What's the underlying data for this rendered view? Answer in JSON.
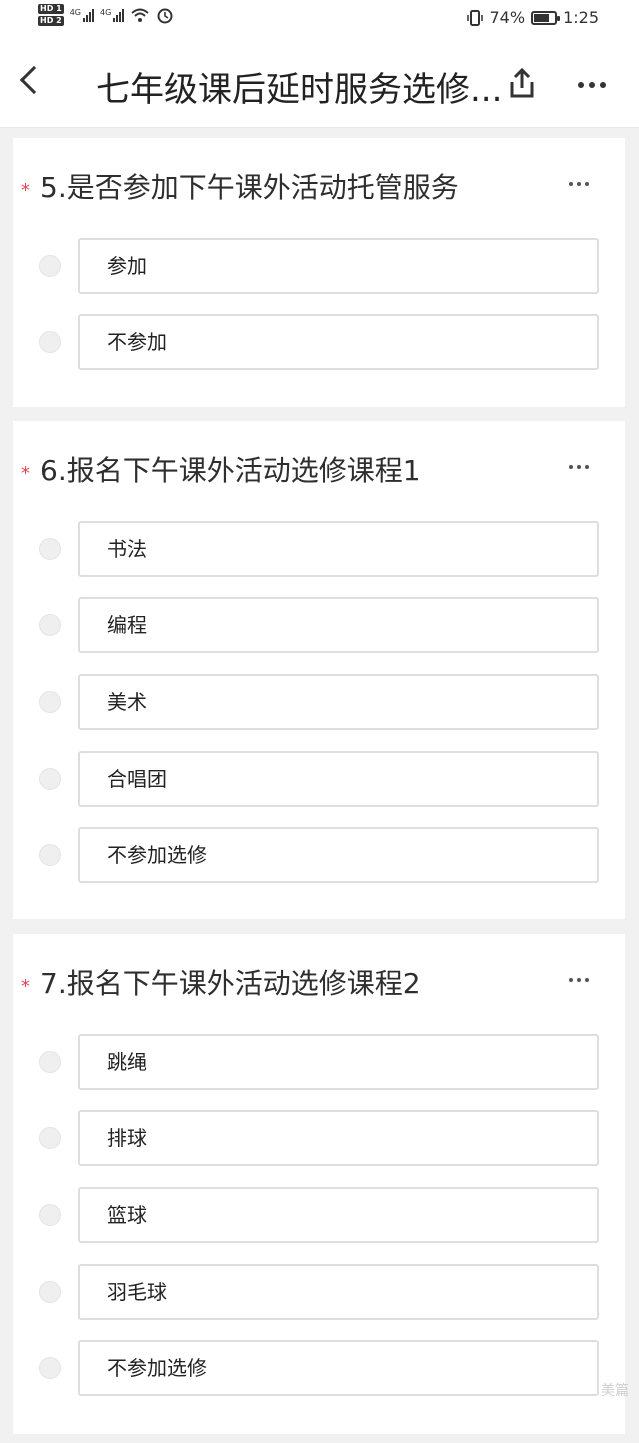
{
  "status_bar": {
    "sim1": "HD 1",
    "sim2": "HD 2",
    "network1": "4G",
    "network2": "4G",
    "battery_percent_text": "74%",
    "battery_level": 0.74,
    "time": "1:25",
    "icons": [
      "signal-icon",
      "wifi-icon",
      "alarm-icon",
      "vibrate-icon",
      "battery-icon"
    ]
  },
  "nav": {
    "title": "七年级课后延时服务选修...",
    "icons": [
      "back-icon",
      "share-icon",
      "more-icon"
    ]
  },
  "questions": [
    {
      "required_mark": "*",
      "title": "5.是否参加下午课外活动托管服务",
      "options": [
        "参加",
        "不参加"
      ]
    },
    {
      "required_mark": "*",
      "title": "6.报名下午课外活动选修课程1",
      "options": [
        "书法",
        "编程",
        "美术",
        "合唱团",
        "不参加选修"
      ]
    },
    {
      "required_mark": "*",
      "title": "7.报名下午课外活动选修课程2",
      "options": [
        "跳绳",
        "排球",
        "篮球",
        "羽毛球",
        "不参加选修"
      ]
    }
  ],
  "watermark": "美篇"
}
